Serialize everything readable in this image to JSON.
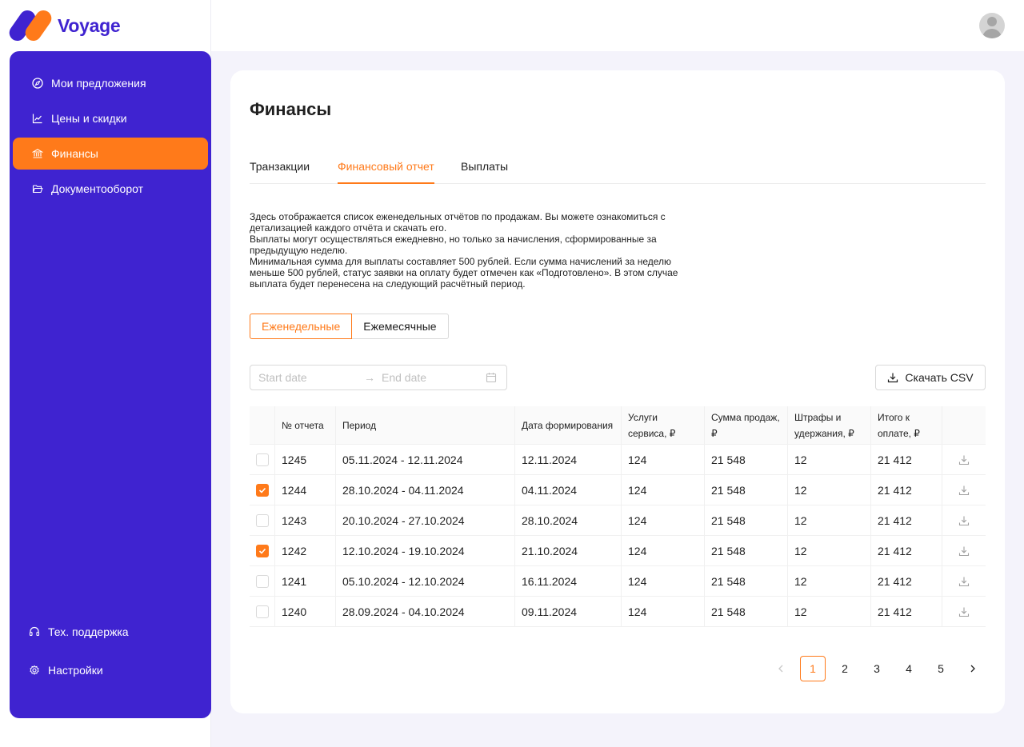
{
  "app": {
    "brand_name": "Voyage",
    "brand_colors": {
      "primary": "#3f23d0",
      "accent": "#ff7a1a"
    }
  },
  "sidebar": {
    "items": [
      {
        "label": "Мои предложения",
        "icon": "compass-icon",
        "active": false
      },
      {
        "label": "Цены и скидки",
        "icon": "line-chart-icon",
        "active": false
      },
      {
        "label": "Финансы",
        "icon": "bank-icon",
        "active": true
      },
      {
        "label": "Документооборот",
        "icon": "folder-open-icon",
        "active": false
      }
    ],
    "bottom": [
      {
        "label": "Тех. поддержка",
        "icon": "headset-icon"
      },
      {
        "label": "Настройки",
        "icon": "gear-icon"
      }
    ]
  },
  "page": {
    "title": "Финансы",
    "tabs": [
      {
        "label": "Транзакции",
        "active": false
      },
      {
        "label": "Финансовый отчет",
        "active": true
      },
      {
        "label": "Выплаты",
        "active": false
      }
    ],
    "description": [
      "Здесь отображается список еженедельных отчётов по продажам. Вы можете ознакомиться с детализацией каждого отчёта и скачать его.",
      "Выплаты могут осуществляться ежедневно, но только за начисления, сформированные за предыдущую неделю.",
      "Минимальная сумма для выплаты составляет 500 рублей. Если сумма начислений за неделю меньше 500 рублей, статус заявки на оплату будет отмечен как «Подготовлено». В этом случае выплата будет перенесена на следующий расчётный период."
    ],
    "period_toggle": {
      "weekly": "Еженедельные",
      "monthly": "Ежемесячные",
      "selected": "weekly"
    },
    "date_range": {
      "start_placeholder": "Start date",
      "end_placeholder": "End date",
      "arrow": "→"
    },
    "csv_button": "Скачать CSV"
  },
  "table": {
    "columns": [
      "№ отчета",
      "Период",
      "Дата формирования",
      "Услуги сервиса, ₽",
      "Сумма продаж, ₽",
      "Штрафы и удержания, ₽",
      "Итого к оплате, ₽"
    ],
    "rows": [
      {
        "checked": false,
        "id": "1245",
        "period": "05.11.2024 - 12.11.2024",
        "date": "12.11.2024",
        "services": "124",
        "sales": "21 548",
        "fines": "12",
        "total": "21 412"
      },
      {
        "checked": true,
        "id": "1244",
        "period": "28.10.2024 - 04.11.2024",
        "date": "04.11.2024",
        "services": "124",
        "sales": "21 548",
        "fines": "12",
        "total": "21 412"
      },
      {
        "checked": false,
        "id": "1243",
        "period": "20.10.2024 - 27.10.2024",
        "date": "28.10.2024",
        "services": "124",
        "sales": "21 548",
        "fines": "12",
        "total": "21 412"
      },
      {
        "checked": true,
        "id": "1242",
        "period": "12.10.2024 - 19.10.2024",
        "date": "21.10.2024",
        "services": "124",
        "sales": "21 548",
        "fines": "12",
        "total": "21 412"
      },
      {
        "checked": false,
        "id": "1241",
        "period": "05.10.2024 - 12.10.2024",
        "date": "16.11.2024",
        "services": "124",
        "sales": "21 548",
        "fines": "12",
        "total": "21 412"
      },
      {
        "checked": false,
        "id": "1240",
        "period": "28.09.2024 - 04.10.2024",
        "date": "09.11.2024",
        "services": "124",
        "sales": "21 548",
        "fines": "12",
        "total": "21 412"
      }
    ]
  },
  "pagination": {
    "pages": [
      "1",
      "2",
      "3",
      "4",
      "5"
    ],
    "current": "1"
  }
}
